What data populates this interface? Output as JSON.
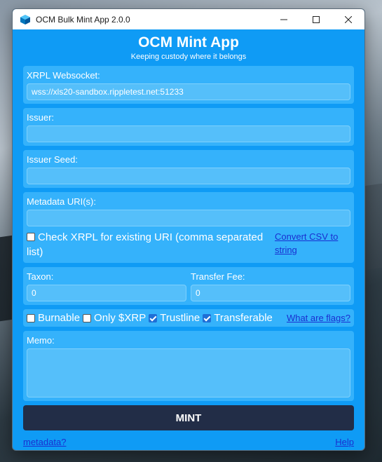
{
  "window": {
    "title": "OCM Bulk Mint App 2.0.0",
    "controls": [
      "minimize-icon",
      "maximize-icon",
      "close-icon"
    ]
  },
  "header": {
    "title": "OCM Mint App",
    "subtitle": "Keeping custody where it belongs"
  },
  "form": {
    "websocket": {
      "label": "XRPL Websocket:",
      "value": "wss://xls20-sandbox.rippletest.net:51233"
    },
    "issuer": {
      "label": "Issuer:",
      "value": ""
    },
    "issuer_seed": {
      "label": "Issuer Seed:",
      "value": ""
    },
    "metadata": {
      "label": "Metadata URI(s):",
      "value": "",
      "check_label": "Check XRPL for existing URI (comma separated list)",
      "check_checked": false,
      "convert_link": "Convert CSV to string"
    },
    "taxon": {
      "label": "Taxon:",
      "value": "0"
    },
    "transfer_fee": {
      "label": "Transfer Fee:",
      "value": "0"
    },
    "flags": {
      "burnable": {
        "label": "Burnable",
        "checked": false
      },
      "only_xrp": {
        "label": "Only $XRP",
        "checked": false
      },
      "trustline": {
        "label": "Trustline",
        "checked": true
      },
      "transferable": {
        "label": "Transferable",
        "checked": true
      },
      "help_link": "What are flags?"
    },
    "memo": {
      "label": "Memo:",
      "value": ""
    }
  },
  "actions": {
    "mint_label": "MINT"
  },
  "footer": {
    "metadata_link": "metadata?",
    "help_link": "Help"
  },
  "colors": {
    "window_bg": "#0f9bf5",
    "panel_bg": "#35b2fb",
    "input_bg": "#55bffa",
    "mint_button": "#222d47",
    "link": "#1a2fd0"
  }
}
